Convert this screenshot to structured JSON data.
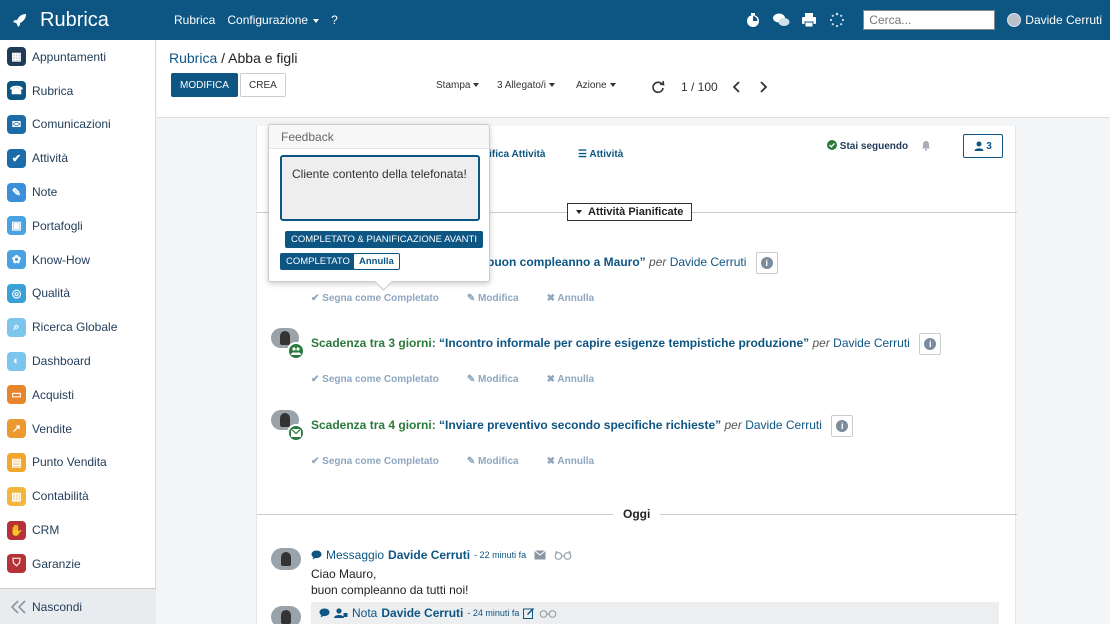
{
  "navbar": {
    "brand": "Rubrica",
    "menu": [
      "Rubrica",
      "Configurazione",
      "?"
    ],
    "search_placeholder": "Cerca...",
    "user_name": "Davide Cerruti"
  },
  "sidebar": {
    "items": [
      {
        "label": "Appuntamenti",
        "color": "#1f3b57",
        "icon": "calendar-icon"
      },
      {
        "label": "Rubrica",
        "color": "#0d5583",
        "icon": "address-book-icon"
      },
      {
        "label": "Comunicazioni",
        "color": "#1b6ca8",
        "icon": "chat-icon"
      },
      {
        "label": "Attività",
        "color": "#1b6ca8",
        "icon": "check-icon"
      },
      {
        "label": "Note",
        "color": "#3b8ed8",
        "icon": "note-icon"
      },
      {
        "label": "Portafogli",
        "color": "#4aa3e0",
        "icon": "lock-icon"
      },
      {
        "label": "Know-How",
        "color": "#4aa3e0",
        "icon": "brain-icon"
      },
      {
        "label": "Qualità",
        "color": "#3aa0d8",
        "icon": "quality-icon"
      },
      {
        "label": "Ricerca Globale",
        "color": "#7cc6ee",
        "icon": "search-icon"
      },
      {
        "label": "Dashboard",
        "color": "#7cc6ee",
        "icon": "dashboard-icon"
      },
      {
        "label": "Acquisti",
        "color": "#e8842a",
        "icon": "purchase-icon"
      },
      {
        "label": "Vendite",
        "color": "#ec9a30",
        "icon": "chart-icon"
      },
      {
        "label": "Punto Vendita",
        "color": "#f0a72c",
        "icon": "pos-icon"
      },
      {
        "label": "Contabilità",
        "color": "#f3b63a",
        "icon": "accounting-icon"
      },
      {
        "label": "CRM",
        "color": "#b53236",
        "icon": "handshake-icon"
      },
      {
        "label": "Garanzie",
        "color": "#b53236",
        "icon": "shield-icon"
      }
    ],
    "footer": "Nascondi"
  },
  "control": {
    "breadcrumb_parent": "Rubrica",
    "breadcrumb_current": "Abba e figli",
    "edit_label": "MODIFICA",
    "create_label": "CREA",
    "print_label": "Stampa",
    "attachments_label": "3 Allegato/i",
    "action_label": "Azione",
    "pager": "1 / 100"
  },
  "chatter": {
    "plan_activity": "nifica Attività",
    "activities": "Attività",
    "following": "Stai seguendo",
    "followers": "3",
    "planned_toggle": "Attività Pianificate",
    "activity_list": [
      {
        "due": "",
        "title": "buon compleanno a Mauro”",
        "by": "per",
        "user": "Davide Cerruti",
        "badge": ""
      },
      {
        "due": "Scadenza tra 3 giorni",
        "title": "“Incontro informale per capire esigenze tempistiche produzione”",
        "by": "per",
        "user": "Davide Cerruti",
        "badge": "people-icon"
      },
      {
        "due": "Scadenza tra 4 giorni",
        "title": "“Inviare preventivo secondo specifiche richieste”",
        "by": "per",
        "user": "Davide Cerruti",
        "badge": "envelope-icon"
      }
    ],
    "activity_actions": [
      "Segna come Completato",
      "Modifica",
      "Annulla"
    ],
    "today": "Oggi",
    "messages": [
      {
        "type": "Messaggio",
        "author": "Davide Cerruti",
        "time": "- 22 minuti fa",
        "body_line1": "Ciao Mauro,",
        "body_line2": "buon compleanno da tutti noi!"
      },
      {
        "type": "Nota",
        "author": "Davide Cerruti",
        "time": "- 24 minuti fa"
      }
    ]
  },
  "popover": {
    "title": "Feedback",
    "text": "Cliente contento della telefonata!",
    "btn_complete_plan": "COMPLETATO & PIANIFICAZIONE AVANTI",
    "btn_complete": "COMPLETATO",
    "btn_cancel": "Annulla"
  },
  "colors": {
    "primary": "#0d5583",
    "success": "#2b7a3d"
  }
}
